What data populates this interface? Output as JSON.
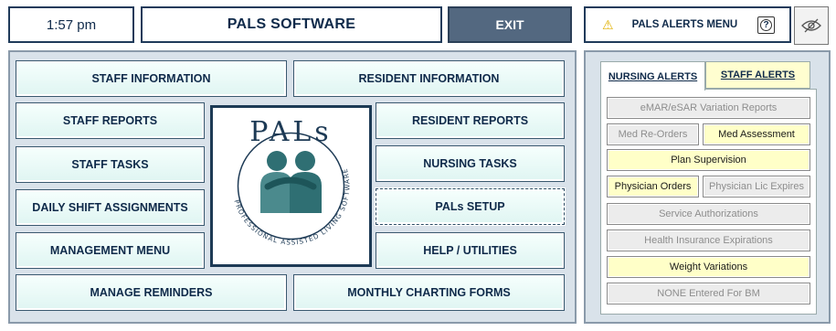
{
  "header": {
    "time": "1:57 pm",
    "title": "PALS SOFTWARE",
    "exit_label": "EXIT",
    "alerts_menu_label": "PALS ALERTS MENU",
    "help_label": "?"
  },
  "menu": {
    "staff_information": "STAFF INFORMATION",
    "resident_information": "RESIDENT INFORMATION",
    "staff_reports": "STAFF REPORTS",
    "resident_reports": "RESIDENT REPORTS",
    "staff_tasks": "STAFF TASKS",
    "nursing_tasks": "NURSING TASKS",
    "daily_shift_assignments": "DAILY SHIFT ASSIGNMENTS",
    "pals_setup": "PALs SETUP",
    "management_menu": "MANAGEMENT MENU",
    "help_utilities": "HELP / UTILITIES",
    "manage_reminders": "MANAGE REMINDERS",
    "monthly_charting_forms": "MONTHLY CHARTING FORMS"
  },
  "logo": {
    "wordmark": "PALs",
    "tagline": "PROFESSIONAL ASSISTED LIVING SOFTWARE"
  },
  "alerts": {
    "tabs": {
      "nursing": "NURSING ALERTS",
      "staff": "STAFF ALERTS"
    },
    "buttons": {
      "emar": "eMAR/eSAR Variation Reports",
      "med_reorders": "Med Re-Orders",
      "med_assessment": "Med Assessment",
      "plan_supervision": "Plan Supervision",
      "physician_orders": "Physician Orders",
      "physician_lic": "Physician Lic Expires",
      "service_auth": "Service Authorizations",
      "health_insurance": "Health Insurance Expirations",
      "weight_variations": "Weight Variations",
      "none_bm": "NONE Entered For BM"
    }
  },
  "colors": {
    "alert_active": "#ffffc8",
    "alert_inactive": "#ececec",
    "exit": "#536880",
    "menu_button": "#dff5f2",
    "logo_teal": "#2f6f73"
  },
  "icons": {
    "warning": "warning-triangle-icon",
    "help": "question-mark-icon",
    "visibility": "eye-slash-icon"
  }
}
